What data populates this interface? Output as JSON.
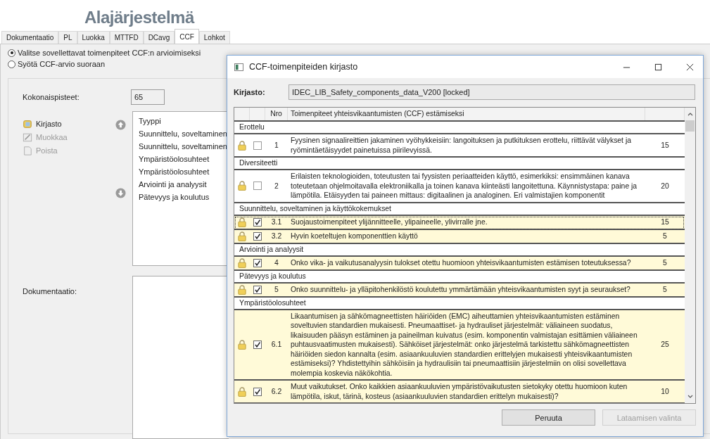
{
  "header": {
    "title": "Alajärjestelmä"
  },
  "tabs": [
    {
      "label": "Dokumentaatio",
      "selected": false
    },
    {
      "label": "PL",
      "selected": false
    },
    {
      "label": "Luokka",
      "selected": false
    },
    {
      "label": "MTTFD",
      "selected": false
    },
    {
      "label": "DCavg",
      "selected": false
    },
    {
      "label": "CCF",
      "selected": true
    },
    {
      "label": "Lohkot",
      "selected": false
    }
  ],
  "ccf_mode": [
    {
      "label": "Valitse sovellettavat toimenpiteet CCF:n arvioimiseksi",
      "selected": true
    },
    {
      "label": "Syötä CCF-arvio suoraan",
      "selected": false
    }
  ],
  "total_points": {
    "label": "Kokonaispisteet:",
    "value": "65"
  },
  "actions": [
    {
      "label": "Kirjasto",
      "kind": "library",
      "disabled": false
    },
    {
      "label": "Muokkaa",
      "kind": "edit",
      "disabled": true
    },
    {
      "label": "Poista",
      "kind": "delete",
      "disabled": true
    }
  ],
  "type_list": {
    "header": "Tyyppi",
    "items": [
      "Suunnittelu, soveltaminen",
      "Suunnittelu, soveltaminen",
      "Ympäristöolosuhteet",
      "Ympäristöolosuhteet",
      "Arviointi ja analyysit",
      "Pätevyys ja koulutus"
    ]
  },
  "documentation": {
    "label": "Dokumentaatio:"
  },
  "dialog": {
    "title": "CCF-toimenpiteiden kirjasto",
    "library_label": "Kirjasto:",
    "library_value": "IDEC_LIB_Safety_components_data_V200 [locked]",
    "columns": [
      "Nro",
      "Toimenpiteet yhteisvikaantumisten (CCF) estämiseksi"
    ],
    "groups": [
      {
        "name": "Erottelu",
        "items": [
          {
            "checked": false,
            "selected": false,
            "number": "1",
            "text": "Fyysinen signaalireittien jakaminen vyöhykkeisiin: langoituksen ja putkituksen erottelu, riittävät välykset ja ryömintäetäisyydet painetuissa piirilevyissä.",
            "points": "15"
          }
        ]
      },
      {
        "name": "Diversiteetti",
        "items": [
          {
            "checked": false,
            "selected": false,
            "number": "2",
            "text": "Erilaisten teknologioiden, toteutusten tai fyysisten periaatteiden käyttö, esimerkiksi: ensimmäinen kanava toteutetaan ohjelmoitavalla elektroniikalla ja toinen kanava kiinteästi langoitettuna. Käynnistystapa: paine ja lämpötila. Etäisyyden tai paineen mittaus: digitaalinen ja analoginen. Eri valmistajien komponentit",
            "points": "20"
          }
        ]
      },
      {
        "name": "Suunnittelu, soveltaminen ja käyttökokemukset",
        "items": [
          {
            "checked": true,
            "selected": true,
            "number": "3.1",
            "text": "Suojaustoimenpiteet ylijännitteelle, ylipaineelle, ylivirralle jne.",
            "points": "15"
          },
          {
            "checked": true,
            "selected": false,
            "number": "3.2",
            "text": "Hyvin koeteltujen komponenttien käyttö",
            "points": "5"
          }
        ]
      },
      {
        "name": "Arviointi ja analyysit",
        "items": [
          {
            "checked": true,
            "selected": false,
            "number": "4",
            "text": "Onko vika- ja vaikutusanalyysin tulokset otettu huomioon yhteisvikaantumisten estämisen toteutuksessa?",
            "points": "5"
          }
        ]
      },
      {
        "name": "Pätevyys ja koulutus",
        "items": [
          {
            "checked": true,
            "selected": false,
            "number": "5",
            "text": "Onko suunnittelu- ja ylläpitohenkilöstö koulutettu ymmärtämään yhteisvikaantumisten syyt ja seuraukset?",
            "points": "5"
          }
        ]
      },
      {
        "name": "Ympäristöolosuhteet",
        "items": [
          {
            "checked": true,
            "selected": false,
            "number": "6.1",
            "text": "Likaantumisen ja sähkömagneettisten häiriöiden (EMC) aiheuttamien yhteisvikaantumisten estäminen soveltuvien standardien mukaisesti. Pneumaattiset- ja hydrauliset järjestelmät: väliaineen suodatus, likaisuuden pääsyn estäminen ja paineilman kuivatus (esim. komponentin valmistajan esittämien väliaineen puhtausvaatimusten mukaisesti). Sähköiset järjestelmät: onko järjestelmä tarkistettu sähkömagneettisten häiriöiden siedon kannalta (esim. asiaankuuluvien standardien erittelyjen mukaisesti yhteisvikaantumisten estämiseksi)? Yhdistettyihin sähköisiin ja hydraulisiin tai pneumaattisiin järjestelmiin on olisi sovellettava molempia koskevia näkökohtia.",
            "points": "25"
          },
          {
            "checked": true,
            "selected": false,
            "number": "6.2",
            "text": "Muut vaikutukset. Onko kaikkien asiaankuuluvien ympäristövaikutusten sietokyky otettu huomioon kuten lämpötila, iskut, tärinä, kosteus (asiaankuuluvien standardien erittelyn mukaisesti)?",
            "points": "10"
          }
        ]
      }
    ],
    "buttons": [
      {
        "label": "Peruuta",
        "disabled": false
      },
      {
        "label": "Lataamisen valinta",
        "disabled": true
      }
    ]
  }
}
